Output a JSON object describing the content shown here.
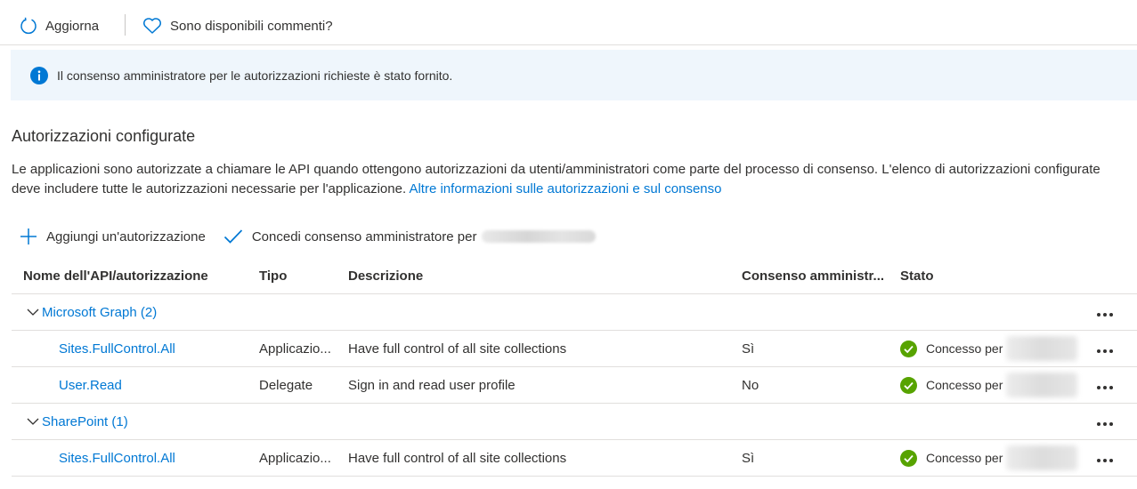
{
  "toolbar": {
    "refresh_label": "Aggiorna",
    "feedback_label": "Sono disponibili commenti?"
  },
  "banner": {
    "message": "Il consenso amministratore per le autorizzazioni richieste è stato fornito."
  },
  "section": {
    "title": "Autorizzazioni configurate",
    "description": "Le applicazioni sono autorizzate a chiamare le API quando ottengono autorizzazioni da utenti/amministratori come parte del processo di consenso. L'elenco di autorizzazioni configurate deve includere tutte le autorizzazioni necessarie per l'applicazione.",
    "learn_more_link": "Altre informazioni sulle autorizzazioni e sul consenso"
  },
  "commands": {
    "add_permission": "Aggiungi un'autorizzazione",
    "grant_consent": "Concedi consenso amministratore per"
  },
  "table": {
    "headers": {
      "name": "Nome dell'API/autorizzazione",
      "type": "Tipo",
      "description": "Descrizione",
      "admin_consent": "Consenso amministr...",
      "status": "Stato"
    },
    "groups": [
      {
        "name": "Microsoft Graph (2)",
        "permissions": [
          {
            "name": "Sites.FullControl.All",
            "type": "Applicazio...",
            "description": "Have full control of all site collections",
            "admin_consent": "Sì",
            "status": "Concesso per"
          },
          {
            "name": "User.Read",
            "type": "Delegate",
            "description": "Sign in and read user profile",
            "admin_consent": "No",
            "status": "Concesso per"
          }
        ]
      },
      {
        "name": "SharePoint (1)",
        "permissions": [
          {
            "name": "Sites.FullControl.All",
            "type": "Applicazio...",
            "description": "Have full control of all site collections",
            "admin_consent": "Sì",
            "status": "Concesso per"
          }
        ]
      }
    ]
  },
  "colors": {
    "accent": "#0078d4",
    "banner_bg": "#eff6fc",
    "success": "#57a300",
    "text": "#323130",
    "border": "#e1dfdd"
  },
  "icons": {
    "refresh": "refresh-icon",
    "feedback": "heart-icon",
    "info": "info-icon",
    "add": "plus-icon",
    "grant": "checkmark-icon",
    "expand": "chevron-down-icon",
    "status_ok": "success-check-icon",
    "more": "more-ellipsis-icon"
  }
}
